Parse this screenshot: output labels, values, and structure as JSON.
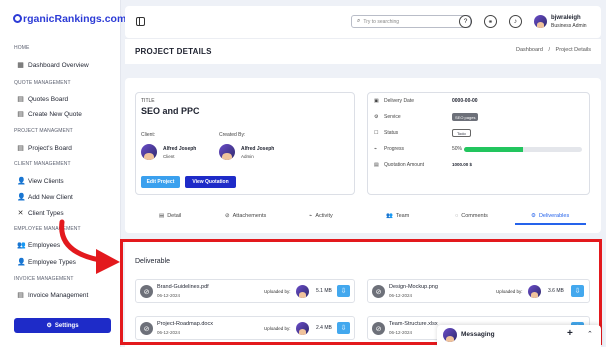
{
  "brand": {
    "logo_text": "rganicRankings.com"
  },
  "sidebar": {
    "sections": [
      {
        "label": "HOME",
        "items": [
          "Dashboard Overview"
        ]
      },
      {
        "label": "QUOTE MANAGEMENT",
        "items": [
          "Quotes Board",
          "Create New Quote"
        ]
      },
      {
        "label": "PROJECT MANAGMENT",
        "items": [
          "Project's Board"
        ]
      },
      {
        "label": "CLIENT MANAGEMENT",
        "items": [
          "View Clients",
          "Add New Client",
          "Client Types"
        ]
      },
      {
        "label": "EMPLOYEE MANAGEMENT",
        "items": [
          "Employees",
          "Employee Types"
        ]
      },
      {
        "label": "INVOICE MANAGEMENT",
        "items": [
          "Invoice Management"
        ]
      }
    ],
    "settings_label": "Settings"
  },
  "topbar": {
    "search_placeholder": "Try to searching",
    "user_name": "bjwraleigh",
    "user_role": "Business Admin"
  },
  "header": {
    "title": "PROJECT DETAILS",
    "breadcrumb": [
      "Dashboard",
      "/",
      "Project Details"
    ]
  },
  "project": {
    "title_label": "TITLE",
    "title": "SEO and PPC",
    "client_label": "Client:",
    "client_name": "Alfred Joseph",
    "client_role": "Client",
    "created_label": "Created By:",
    "creator_name": "Alfred Joseph",
    "creator_role": "Admin",
    "edit_label": "Edit Project",
    "quote_label": "View Quotation"
  },
  "details": {
    "delivery_label": "Delivery Date",
    "delivery_value": "0000-00-00",
    "service_label": "Service",
    "service_value": "SEO pages",
    "status_label": "Status",
    "status_value": "Todo",
    "progress_label": "Progress",
    "progress_value": "50%",
    "progress_fraction": 0.5,
    "amount_label": "Quotation Amount",
    "amount_value": "1000.00 $"
  },
  "tabs": [
    "Detail",
    "Attachements",
    "Activity",
    "Team",
    "Comments",
    "Deliverables"
  ],
  "deliverables": {
    "title": "Deliverable",
    "uploaded_label": "Uploaded by:",
    "files": [
      {
        "name": "Brand-Guidelines.pdf",
        "date": "06-12-2024",
        "size": "5.1 MB"
      },
      {
        "name": "Design-Mockup.png",
        "date": "06-12-2024",
        "size": "3.6 MB"
      },
      {
        "name": "Project-Roadmap.docx",
        "date": "06-12-2024",
        "size": "2.4 MB"
      },
      {
        "name": "Team-Structure.xlsx",
        "date": "06-12-2024",
        "size": ""
      }
    ]
  },
  "messaging": {
    "label": "Messaging"
  },
  "colors": {
    "accent": "#1e2bc8",
    "progress": "#22c55e",
    "download": "#43a8ee",
    "highlight": "#e3191d"
  }
}
